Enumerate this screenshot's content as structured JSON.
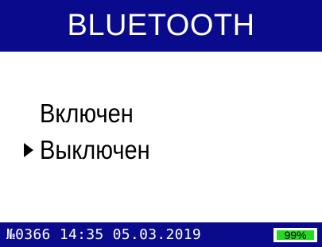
{
  "header": {
    "title": "BLUETOOTH"
  },
  "menu": {
    "items": [
      {
        "label": "Включен",
        "selected": false
      },
      {
        "label": "Выключен",
        "selected": true
      }
    ],
    "cursor_icon": "triangle-right-icon"
  },
  "status_bar": {
    "device_number": "№0366",
    "time": "14:35",
    "date": "05.03.2019",
    "battery_label": "99%",
    "battery_level": 0.99
  },
  "colors": {
    "bar_background": "#0a0a8c",
    "battery_fill": "#27d827",
    "text_light": "#ffffff",
    "text_dark": "#000000"
  }
}
